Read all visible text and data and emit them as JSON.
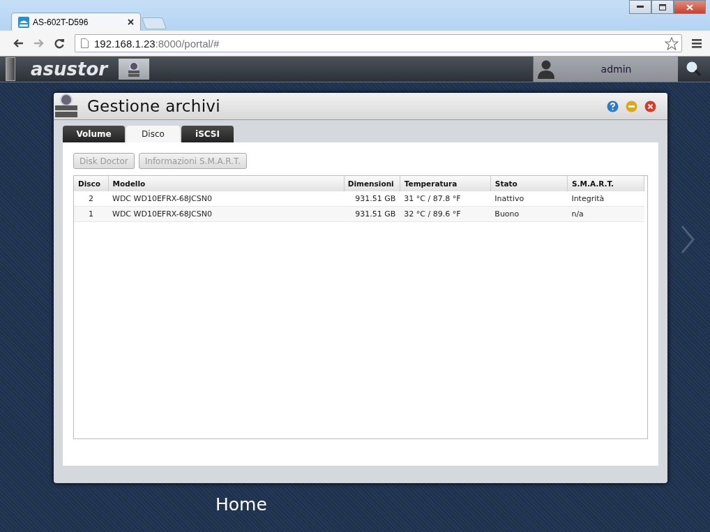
{
  "browser": {
    "tab_title": "AS-602T-D596",
    "url_host": "192.168.1.23",
    "url_path": ":8000/portal/#"
  },
  "topbar": {
    "logo": "asustor",
    "user": "admin"
  },
  "window": {
    "title": "Gestione archivi"
  },
  "tabs": [
    {
      "label": "Volume",
      "selected": false
    },
    {
      "label": "Disco",
      "selected": true
    },
    {
      "label": "iSCSI",
      "selected": false
    }
  ],
  "buttons": [
    {
      "label": "Disk Doctor",
      "disabled": true
    },
    {
      "label": "Informazioni S.M.A.R.T.",
      "disabled": true
    }
  ],
  "table": {
    "columns": [
      "Disco",
      "Modello",
      "Dimensioni",
      "Temperatura",
      "Stato",
      "S.M.A.R.T."
    ],
    "rows": [
      [
        "2",
        "WDC WD10EFRX-68JCSN0",
        "931.51 GB",
        "31 °C / 87.8 °F",
        "Inattivo",
        "Integrità"
      ],
      [
        "1",
        "WDC WD10EFRX-68JCSN0",
        "931.51 GB",
        "32 °C / 89.6 °F",
        "Buono",
        "n/a"
      ]
    ]
  },
  "desktop": {
    "label": "Home"
  }
}
